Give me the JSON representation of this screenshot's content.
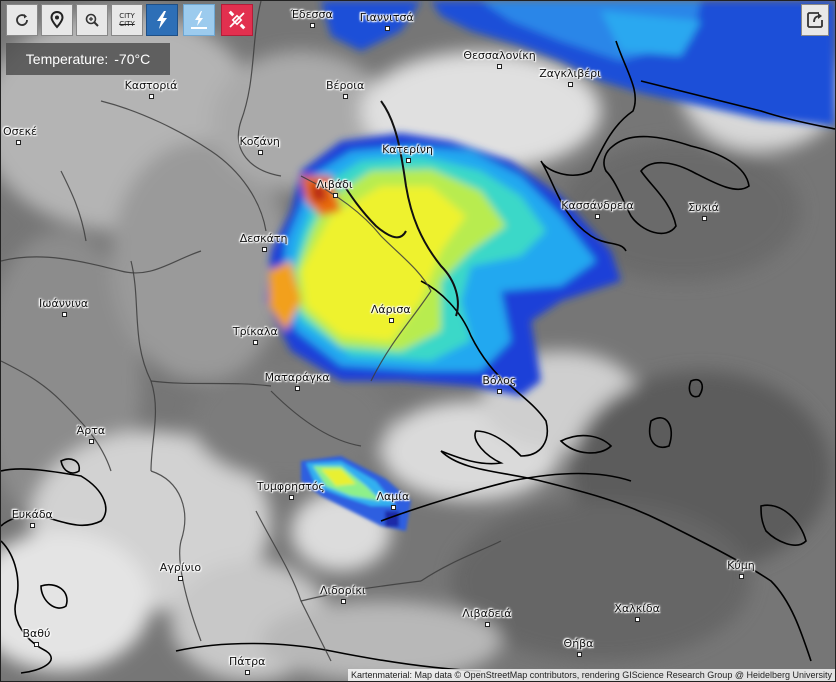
{
  "toolbar": {
    "buttons": [
      {
        "name": "refresh-icon"
      },
      {
        "name": "location-pin-icon"
      },
      {
        "name": "zoom-icon"
      },
      {
        "name": "city-labels-toggle",
        "line1": "CITY",
        "line2": "CITY"
      },
      {
        "name": "lightning-icon"
      },
      {
        "name": "lightning-ground-icon"
      },
      {
        "name": "satellite-off-icon"
      }
    ],
    "share_icon": "share-icon"
  },
  "temperature_readout": {
    "label": "Temperature:",
    "value": "-70°C"
  },
  "attribution": "Kartenmaterial: Map data © OpenStreetMap contributors, rendering GIScience Research Group @ Heidelberg University",
  "cities": [
    {
      "name": "Έδεσσα",
      "lon": 22.04,
      "lat": 40.8
    },
    {
      "name": "Γιαννιτσά",
      "lon": 22.4,
      "lat": 40.79
    },
    {
      "name": "Θεσσαλονίκη",
      "lon": 22.94,
      "lat": 40.64
    },
    {
      "name": "Ζαγκλιβέρι",
      "lon": 23.28,
      "lat": 40.57
    },
    {
      "name": "Καστοριά",
      "lon": 21.27,
      "lat": 40.52
    },
    {
      "name": "Βέροια",
      "lon": 22.2,
      "lat": 40.52
    },
    {
      "name": "Κοζάνη",
      "lon": 21.79,
      "lat": 40.3
    },
    {
      "name": "Κατερίνη",
      "lon": 22.5,
      "lat": 40.27
    },
    {
      "name": "Λιβάδι",
      "lon": 22.15,
      "lat": 40.13
    },
    {
      "name": "Κασσάνδρεια",
      "lon": 23.41,
      "lat": 40.05
    },
    {
      "name": "Συκιά",
      "lon": 23.92,
      "lat": 40.04
    },
    {
      "name": "Δεσκάτη",
      "lon": 21.81,
      "lat": 39.92
    },
    {
      "name": "Ιωάννινα",
      "lon": 20.85,
      "lat": 39.66
    },
    {
      "name": "Λάρισα",
      "lon": 22.42,
      "lat": 39.64
    },
    {
      "name": "Τρίκαλα",
      "lon": 21.77,
      "lat": 39.55
    },
    {
      "name": "Ματαράγκα",
      "lon": 21.97,
      "lat": 39.37
    },
    {
      "name": "Βόλος",
      "lon": 22.94,
      "lat": 39.36
    },
    {
      "name": "Άρτα",
      "lon": 20.98,
      "lat": 39.16
    },
    {
      "name": "Τυμφρηστός",
      "lon": 21.94,
      "lat": 38.94
    },
    {
      "name": "Λαμία",
      "lon": 22.43,
      "lat": 38.9
    },
    {
      "name": "Ευκάδα",
      "lon": 20.7,
      "lat": 38.83
    },
    {
      "name": "Αγρίνιο",
      "lon": 21.41,
      "lat": 38.62
    },
    {
      "name": "Κύμη",
      "lon": 24.1,
      "lat": 38.63
    },
    {
      "name": "Λιδορίκι",
      "lon": 22.19,
      "lat": 38.53
    },
    {
      "name": "Χαλκίδα",
      "lon": 23.6,
      "lat": 38.46
    },
    {
      "name": "Λιβαδειά",
      "lon": 22.88,
      "lat": 38.44
    },
    {
      "name": "Θήβα",
      "lon": 23.32,
      "lat": 38.32
    },
    {
      "name": "Πάτρα",
      "lon": 21.73,
      "lat": 38.25
    },
    {
      "name": "Βαθύ",
      "lon": 20.72,
      "lat": 38.36
    },
    {
      "name": "Οσεκέ",
      "lon": 20.63,
      "lat": 40.34
    }
  ]
}
